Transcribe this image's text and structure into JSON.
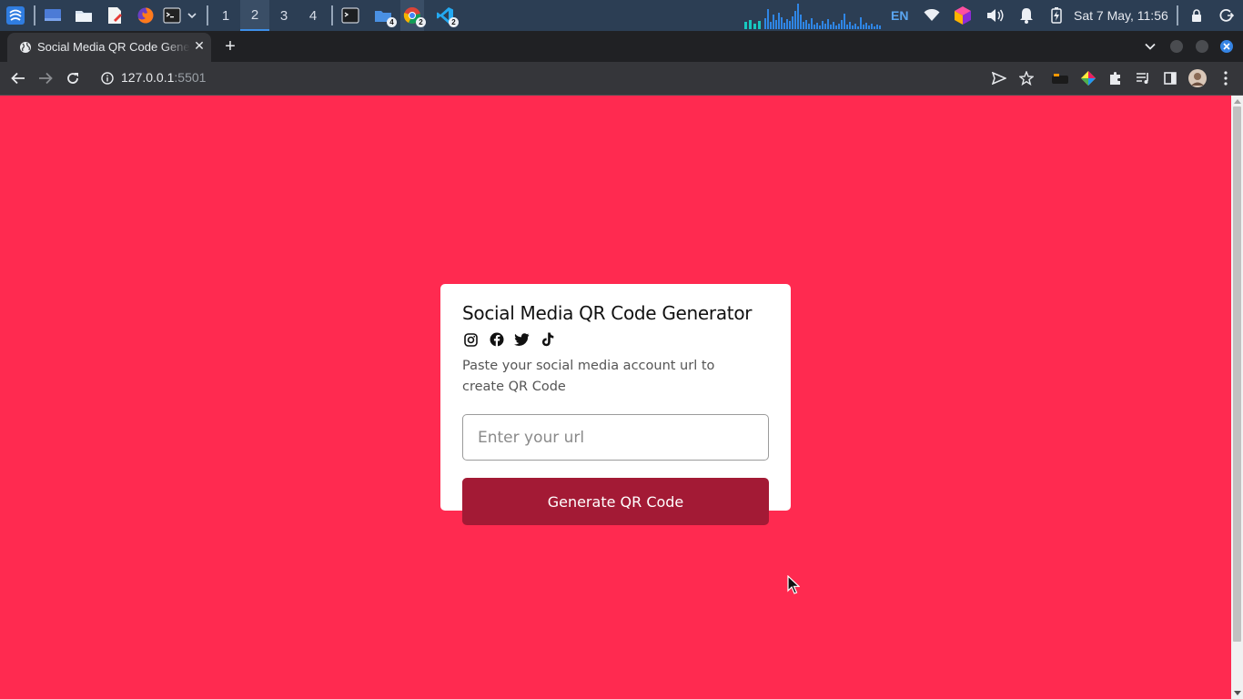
{
  "system_bar": {
    "workspaces": [
      "1",
      "2",
      "3",
      "4"
    ],
    "active_workspace": "2",
    "file_manager_badge": "4",
    "chrome_badge": "2",
    "vscode_badge": "2",
    "language": "EN",
    "clock": "Sat  7 May, 11:56",
    "bar_color": "#2c3e54"
  },
  "browser": {
    "tab_title": "Social Media QR Code Generator",
    "tab_close": "✕",
    "new_tab": "+",
    "url_host": "127.0.0.1",
    "url_port": ":5501"
  },
  "page": {
    "background": "#ff2a50",
    "title": "Social Media QR Code Generator",
    "social_icons": [
      "instagram-icon",
      "facebook-icon",
      "twitter-icon",
      "tiktok-icon"
    ],
    "description": "Paste your social media account url to create QR Code",
    "input_placeholder": "Enter your url",
    "input_value": "",
    "button_label": "Generate QR Code",
    "button_color": "#a31a35"
  }
}
